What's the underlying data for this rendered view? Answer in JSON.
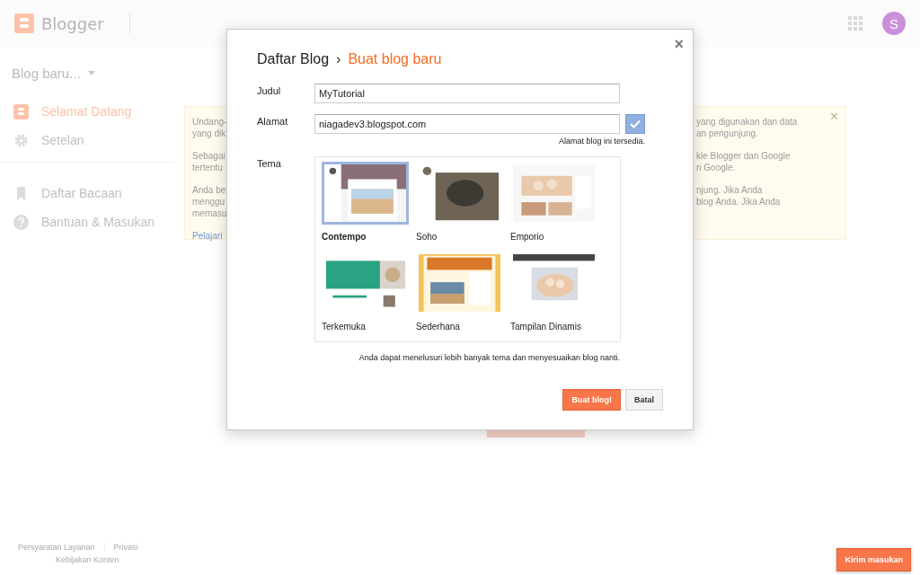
{
  "header": {
    "logo_text": "Blogger",
    "avatar_letter": "S"
  },
  "sidebar": {
    "blog_selector": "Blog baru...",
    "groups": [
      [
        {
          "label": "Selamat Datang",
          "kind": "blogger",
          "selected": true
        },
        {
          "label": "Setelan",
          "kind": "gear",
          "selected": false
        }
      ],
      [
        {
          "label": "Daftar Bacaan",
          "kind": "bookmark",
          "selected": false
        },
        {
          "label": "Bantuan & Masukan",
          "kind": "help",
          "selected": false
        }
      ]
    ]
  },
  "notice": {
    "left_paragraphs": [
      [
        "Undang-",
        "yang dik"
      ],
      [
        "Sebagai",
        "tertentu"
      ],
      [
        "Anda be",
        "menggu",
        "memasu"
      ]
    ],
    "left_link": "Pelajari",
    "right_paragraphs": [
      [
        "yang digunakan dan data",
        "an pengunjung."
      ],
      [
        "kie Blogger dan Google",
        "n Google."
      ],
      [
        "njung. Jika Anda",
        "blog Anda. Jika Anda"
      ]
    ],
    "close": "×"
  },
  "footer": {
    "links": [
      "Persyaratan Layanan",
      "Privasi"
    ],
    "second_line": "Kebijakan Konten"
  },
  "dialog": {
    "breadcrumb": [
      "Daftar Blog",
      "Buat blog baru"
    ],
    "separator": "›",
    "close": "×",
    "fields": [
      {
        "label": "Judul",
        "value": "MyTutorial"
      },
      {
        "label": "Alamat",
        "value": "niagadev3.blogspot.com",
        "verified": true,
        "status": "Alamat blog ini tersedia."
      }
    ],
    "theme_label": "Tema",
    "themes": [
      {
        "name": "Contempo",
        "selected": true
      },
      {
        "name": "Soho",
        "selected": false
      },
      {
        "name": "Emporio",
        "selected": false
      },
      {
        "name": "Terkemuka",
        "selected": false
      },
      {
        "name": "Sederhana",
        "selected": false
      },
      {
        "name": "Tampilan Dinamis",
        "selected": false
      }
    ],
    "hint": "Anda dapat menelusuri lebih banyak tema dan menyesuaikan blog nanti.",
    "buttons": [
      {
        "label": "Buat blog!",
        "kind": "primary"
      },
      {
        "label": "Batal",
        "kind": "secondary"
      }
    ]
  },
  "feedback_button": "Kirim masukan"
}
